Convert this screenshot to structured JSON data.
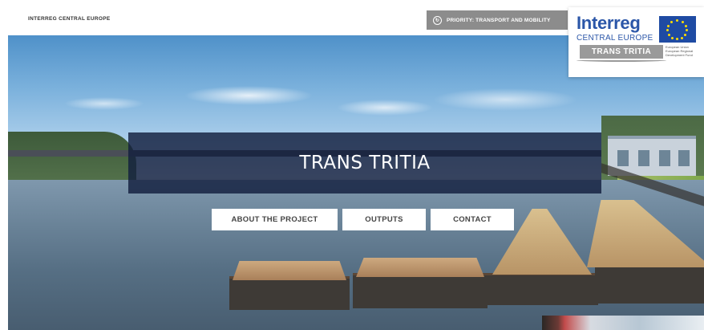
{
  "header": {
    "brand": "INTERREG CENTRAL EUROPE",
    "priority_label": "PRIORITY: TRANSPORT AND MOBILITY",
    "priority_icon": "circle-arrow-icon"
  },
  "logo": {
    "interreg": "Interreg",
    "central_europe": "CENTRAL EUROPE",
    "project": "TRANS TRITIA",
    "eu_caption": "European Union European Regional Development Fund"
  },
  "hero": {
    "title": "TRANS TRITIA"
  },
  "nav": {
    "about": "ABOUT THE PROJECT",
    "outputs": "OUTPUTS",
    "contact": "CONTACT"
  },
  "colors": {
    "title_band": "#121e3e",
    "interreg_blue": "#2b56a8",
    "priority_gray": "#8c8c8c",
    "eu_blue": "#1f4ba3",
    "eu_gold": "#ffdd00"
  }
}
